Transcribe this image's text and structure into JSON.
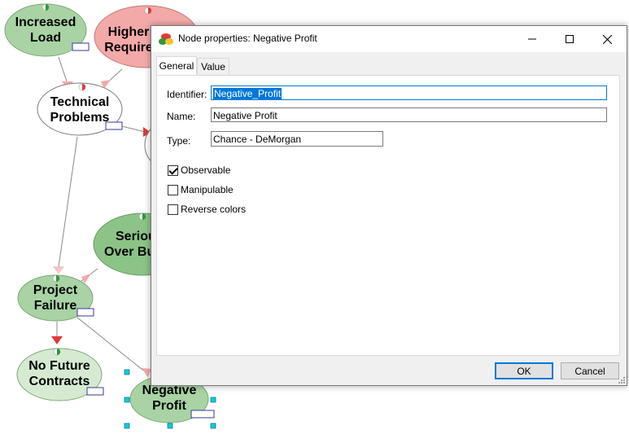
{
  "graph": {
    "nodes": [
      {
        "id": "increased-load",
        "line1": "Increased",
        "line2": "Load"
      },
      {
        "id": "higher-requirements",
        "line1": "Higher",
        "line2": "Require"
      },
      {
        "id": "technical-problems",
        "line1": "Technical",
        "line2": "Problems"
      },
      {
        "id": "serious-over-budget",
        "line1": "Seriou",
        "line2": "Over Bu"
      },
      {
        "id": "project-failure",
        "line1": "Project",
        "line2": "Failure"
      },
      {
        "id": "no-future-contracts",
        "line1": "No Future",
        "line2": "Contracts"
      },
      {
        "id": "negative-profit",
        "line1": "Negative",
        "line2": "Profit"
      }
    ],
    "colors": {
      "green_node": "#a9d3a4",
      "dark_green_node": "#8cc487",
      "pink_node": "#f4a9a9",
      "white_node": "#ffffff",
      "light_green_node": "#d6ead2",
      "selection": "#00b0c8"
    }
  },
  "dialog": {
    "title": "Node properties: Negative Profit",
    "tabs": [
      "General",
      "Value"
    ],
    "fields": {
      "identifier_label": "Identifier:",
      "identifier_value": "Negative_Profit",
      "name_label": "Name:",
      "name_value": "Negative Profit",
      "type_label": "Type:",
      "type_value": "Chance - DeMorgan"
    },
    "checkboxes": [
      {
        "label": "Observable",
        "checked": true
      },
      {
        "label": "Manipulable",
        "checked": false
      },
      {
        "label": "Reverse colors",
        "checked": false
      }
    ],
    "buttons": {
      "ok": "OK",
      "cancel": "Cancel"
    },
    "window_controls": {
      "minimize": "minimize-icon",
      "maximize": "maximize-icon",
      "close": "close-icon"
    }
  }
}
